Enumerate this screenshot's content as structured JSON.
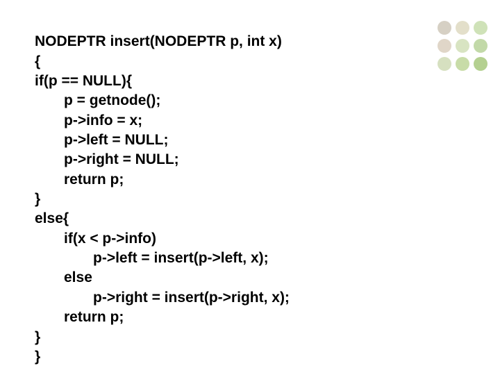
{
  "code": {
    "l1": "NODEPTR insert(NODEPTR p, int x)",
    "l2": "{",
    "l3": "if(p == NULL){",
    "l4": "p = getnode();",
    "l5": "p->info = x;",
    "l6": "p->left = NULL;",
    "l7": "p->right = NULL;",
    "l8": "return p;",
    "l9": "}",
    "l10": "else{",
    "l11": "if(x < p->info)",
    "l12": "p->left = insert(p->left, x);",
    "l13": "else",
    "l14": "p->right = insert(p->right, x);",
    "l15": "return p;",
    "l16": "}",
    "l17": "}"
  }
}
